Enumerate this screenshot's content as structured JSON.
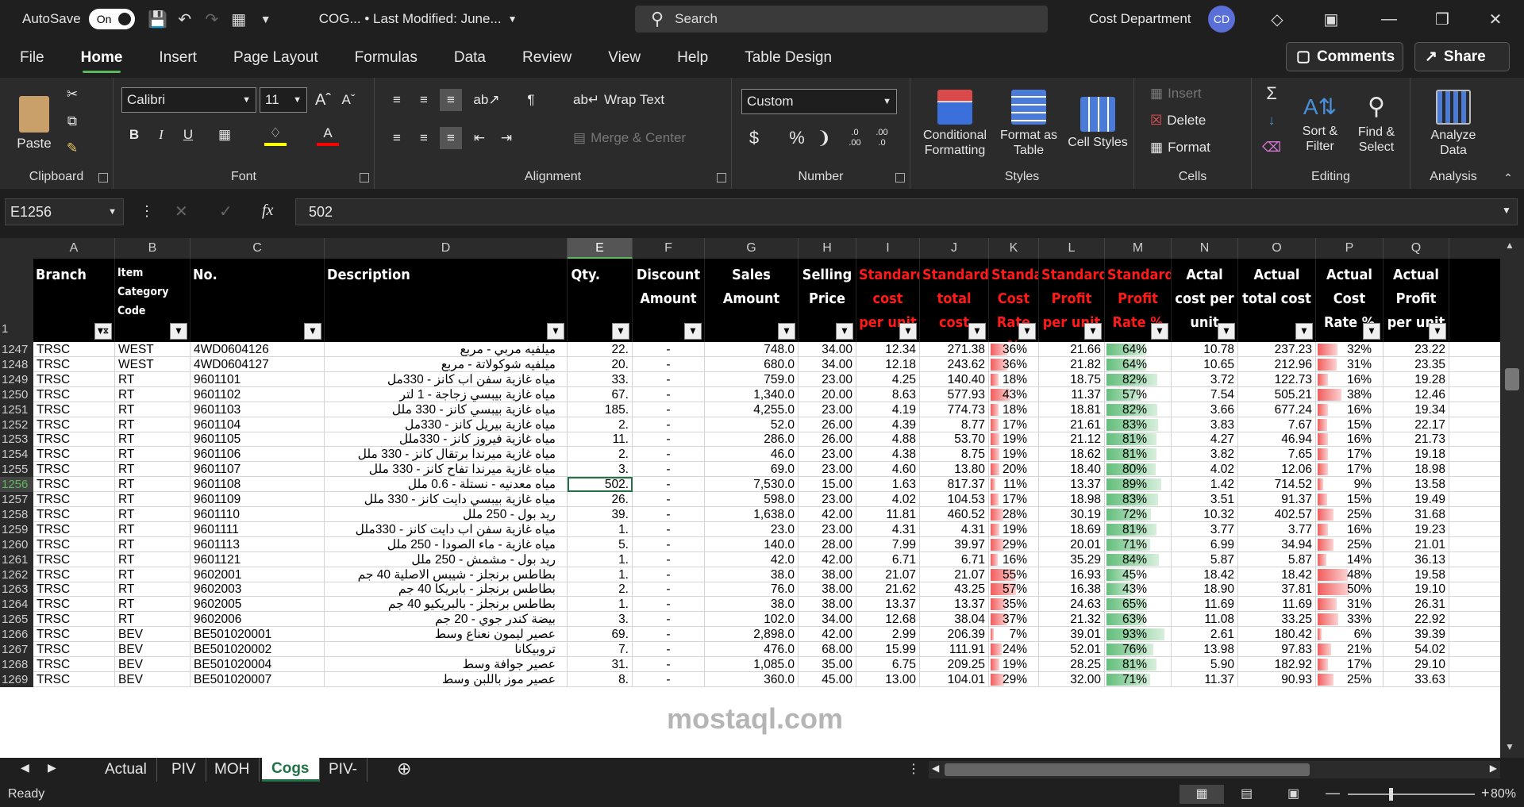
{
  "titlebar": {
    "autosave_label": "AutoSave",
    "autosave_state": "On",
    "file_title": "COG...  •  Last Modified: June...",
    "search_placeholder": "Search",
    "user_name": "Cost Department",
    "user_initials": "CD"
  },
  "menu": {
    "tabs": [
      "File",
      "Home",
      "Insert",
      "Page Layout",
      "Formulas",
      "Data",
      "Review",
      "View",
      "Help",
      "Table Design"
    ],
    "active": "Home",
    "comments_label": "Comments",
    "share_label": "Share"
  },
  "ribbon": {
    "clipboard": {
      "label": "Clipboard",
      "paste": "Paste"
    },
    "font": {
      "label": "Font",
      "font_name": "Calibri",
      "font_size": "11"
    },
    "alignment": {
      "label": "Alignment",
      "wrap_text": "Wrap Text",
      "merge_center": "Merge & Center"
    },
    "number": {
      "label": "Number",
      "format": "Custom"
    },
    "styles": {
      "label": "Styles",
      "conditional": "Conditional Formatting",
      "format_table": "Format as Table",
      "cell_styles": "Cell Styles"
    },
    "cells": {
      "label": "Cells",
      "insert": "Insert",
      "delete": "Delete",
      "format": "Format"
    },
    "editing": {
      "label": "Editing",
      "sort_filter": "Sort & Filter",
      "find_select": "Find & Select"
    },
    "analysis": {
      "label": "Analysis",
      "analyze": "Analyze Data"
    }
  },
  "formula_bar": {
    "name_box": "E1256",
    "fx": "fx",
    "formula": "502"
  },
  "columns": [
    "A",
    "B",
    "C",
    "D",
    "E",
    "F",
    "G",
    "H",
    "I",
    "J",
    "K",
    "L",
    "M",
    "N",
    "O",
    "P",
    "Q"
  ],
  "selected_column": "E",
  "header_row_number": "1",
  "headers": [
    "Branch",
    "Item Category Code",
    "No.",
    "Description",
    "Qty.",
    "Discount Amount",
    "Sales Amount",
    "Selling Price",
    "Standard cost per unit",
    "Standard total cost",
    "Standard Cost Rate %",
    "Standard Profit per unit",
    "Standard Profit Rate %",
    "Actal cost per unit",
    "Actual total cost",
    "Actual Cost Rate %",
    "Actual Profit per unit"
  ],
  "rows": [
    {
      "n": "1247",
      "a": "TRSC",
      "b": "WEST",
      "c": "4WD0604126",
      "d": "ميلفيه مربي - مربع",
      "e": "22.",
      "f": "-",
      "g": "748.0",
      "h": "34.00",
      "i": "12.34",
      "j": "271.38",
      "k": "36%",
      "kv": 36,
      "l": "21.66",
      "m": "64%",
      "mv": 64,
      "n2": "10.78",
      "o": "237.23",
      "p": "32%",
      "pv": 32,
      "q": "23.22"
    },
    {
      "n": "1248",
      "a": "TRSC",
      "b": "WEST",
      "c": "4WD0604127",
      "d": "ميلفيه شوكولاتة - مربع",
      "e": "20.",
      "f": "-",
      "g": "680.0",
      "h": "34.00",
      "i": "12.18",
      "j": "243.62",
      "k": "36%",
      "kv": 36,
      "l": "21.82",
      "m": "64%",
      "mv": 64,
      "n2": "10.65",
      "o": "212.96",
      "p": "31%",
      "pv": 31,
      "q": "23.35"
    },
    {
      "n": "1249",
      "a": "TRSC",
      "b": "RT",
      "c": "9601101",
      "d": "مياه غازية سفن اب كانز - 330مل",
      "e": "33.",
      "f": "-",
      "g": "759.0",
      "h": "23.00",
      "i": "4.25",
      "j": "140.40",
      "k": "18%",
      "kv": 18,
      "l": "18.75",
      "m": "82%",
      "mv": 82,
      "n2": "3.72",
      "o": "122.73",
      "p": "16%",
      "pv": 16,
      "q": "19.28"
    },
    {
      "n": "1250",
      "a": "TRSC",
      "b": "RT",
      "c": "9601102",
      "d": "مياه غازية بيبسي زجاجة - 1 لتر",
      "e": "67.",
      "f": "-",
      "g": "1,340.0",
      "h": "20.00",
      "i": "8.63",
      "j": "577.93",
      "k": "43%",
      "kv": 43,
      "l": "11.37",
      "m": "57%",
      "mv": 57,
      "n2": "7.54",
      "o": "505.21",
      "p": "38%",
      "pv": 38,
      "q": "12.46"
    },
    {
      "n": "1251",
      "a": "TRSC",
      "b": "RT",
      "c": "9601103",
      "d": "مياه غازية بيبسي كانز - 330 ملل",
      "e": "185.",
      "f": "-",
      "g": "4,255.0",
      "h": "23.00",
      "i": "4.19",
      "j": "774.73",
      "k": "18%",
      "kv": 18,
      "l": "18.81",
      "m": "82%",
      "mv": 82,
      "n2": "3.66",
      "o": "677.24",
      "p": "16%",
      "pv": 16,
      "q": "19.34"
    },
    {
      "n": "1252",
      "a": "TRSC",
      "b": "RT",
      "c": "9601104",
      "d": "مياه غازية بيريل كانز - 330مل",
      "e": "2.",
      "f": "-",
      "g": "52.0",
      "h": "26.00",
      "i": "4.39",
      "j": "8.77",
      "k": "17%",
      "kv": 17,
      "l": "21.61",
      "m": "83%",
      "mv": 83,
      "n2": "3.83",
      "o": "7.67",
      "p": "15%",
      "pv": 15,
      "q": "22.17"
    },
    {
      "n": "1253",
      "a": "TRSC",
      "b": "RT",
      "c": "9601105",
      "d": "مياه غازية فيروز كانز - 330ملل",
      "e": "11.",
      "f": "-",
      "g": "286.0",
      "h": "26.00",
      "i": "4.88",
      "j": "53.70",
      "k": "19%",
      "kv": 19,
      "l": "21.12",
      "m": "81%",
      "mv": 81,
      "n2": "4.27",
      "o": "46.94",
      "p": "16%",
      "pv": 16,
      "q": "21.73"
    },
    {
      "n": "1254",
      "a": "TRSC",
      "b": "RT",
      "c": "9601106",
      "d": "مياه غازية ميرندا برتقال كانز - 330 ملل",
      "e": "2.",
      "f": "-",
      "g": "46.0",
      "h": "23.00",
      "i": "4.38",
      "j": "8.75",
      "k": "19%",
      "kv": 19,
      "l": "18.62",
      "m": "81%",
      "mv": 81,
      "n2": "3.82",
      "o": "7.65",
      "p": "17%",
      "pv": 17,
      "q": "19.18"
    },
    {
      "n": "1255",
      "a": "TRSC",
      "b": "RT",
      "c": "9601107",
      "d": "مياه غازية ميرندا تفاح كانز - 330 ملل",
      "e": "3.",
      "f": "-",
      "g": "69.0",
      "h": "23.00",
      "i": "4.60",
      "j": "13.80",
      "k": "20%",
      "kv": 20,
      "l": "18.40",
      "m": "80%",
      "mv": 80,
      "n2": "4.02",
      "o": "12.06",
      "p": "17%",
      "pv": 17,
      "q": "18.98"
    },
    {
      "n": "1256",
      "a": "TRSC",
      "b": "RT",
      "c": "9601108",
      "d": "مياه معدنيه - نستلة - 0.6 ملل",
      "e": "502.",
      "f": "-",
      "g": "7,530.0",
      "h": "15.00",
      "i": "1.63",
      "j": "817.37",
      "k": "11%",
      "kv": 11,
      "l": "13.37",
      "m": "89%",
      "mv": 89,
      "n2": "1.42",
      "o": "714.52",
      "p": "9%",
      "pv": 9,
      "q": "13.58",
      "sel": true
    },
    {
      "n": "1257",
      "a": "TRSC",
      "b": "RT",
      "c": "9601109",
      "d": "مياه غازية بيبسي دايت كانز - 330 ملل",
      "e": "26.",
      "f": "-",
      "g": "598.0",
      "h": "23.00",
      "i": "4.02",
      "j": "104.53",
      "k": "17%",
      "kv": 17,
      "l": "18.98",
      "m": "83%",
      "mv": 83,
      "n2": "3.51",
      "o": "91.37",
      "p": "15%",
      "pv": 15,
      "q": "19.49"
    },
    {
      "n": "1258",
      "a": "TRSC",
      "b": "RT",
      "c": "9601110",
      "d": "ريد بول - 250 ملل",
      "e": "39.",
      "f": "-",
      "g": "1,638.0",
      "h": "42.00",
      "i": "11.81",
      "j": "460.52",
      "k": "28%",
      "kv": 28,
      "l": "30.19",
      "m": "72%",
      "mv": 72,
      "n2": "10.32",
      "o": "402.57",
      "p": "25%",
      "pv": 25,
      "q": "31.68"
    },
    {
      "n": "1259",
      "a": "TRSC",
      "b": "RT",
      "c": "9601111",
      "d": "مياه غازية سفن اب دايت كانز - 330ملل",
      "e": "1.",
      "f": "-",
      "g": "23.0",
      "h": "23.00",
      "i": "4.31",
      "j": "4.31",
      "k": "19%",
      "kv": 19,
      "l": "18.69",
      "m": "81%",
      "mv": 81,
      "n2": "3.77",
      "o": "3.77",
      "p": "16%",
      "pv": 16,
      "q": "19.23"
    },
    {
      "n": "1260",
      "a": "TRSC",
      "b": "RT",
      "c": "9601113",
      "d": "مياه غازية - ماء الصودا - 250 ملل",
      "e": "5.",
      "f": "-",
      "g": "140.0",
      "h": "28.00",
      "i": "7.99",
      "j": "39.97",
      "k": "29%",
      "kv": 29,
      "l": "20.01",
      "m": "71%",
      "mv": 71,
      "n2": "6.99",
      "o": "34.94",
      "p": "25%",
      "pv": 25,
      "q": "21.01"
    },
    {
      "n": "1261",
      "a": "TRSC",
      "b": "RT",
      "c": "9601121",
      "d": "ريد بول - مشمش - 250 ملل",
      "e": "1.",
      "f": "-",
      "g": "42.0",
      "h": "42.00",
      "i": "6.71",
      "j": "6.71",
      "k": "16%",
      "kv": 16,
      "l": "35.29",
      "m": "84%",
      "mv": 84,
      "n2": "5.87",
      "o": "5.87",
      "p": "14%",
      "pv": 14,
      "q": "36.13"
    },
    {
      "n": "1262",
      "a": "TRSC",
      "b": "RT",
      "c": "9602001",
      "d": "بطاطس برنجلز - شيبس الاصلية 40 جم",
      "e": "1.",
      "f": "-",
      "g": "38.0",
      "h": "38.00",
      "i": "21.07",
      "j": "21.07",
      "k": "55%",
      "kv": 55,
      "l": "16.93",
      "m": "45%",
      "mv": 45,
      "n2": "18.42",
      "o": "18.42",
      "p": "48%",
      "pv": 48,
      "q": "19.58"
    },
    {
      "n": "1263",
      "a": "TRSC",
      "b": "RT",
      "c": "9602003",
      "d": "بطاطس برنجلز - بابريكا 40 جم",
      "e": "2.",
      "f": "-",
      "g": "76.0",
      "h": "38.00",
      "i": "21.62",
      "j": "43.25",
      "k": "57%",
      "kv": 57,
      "l": "16.38",
      "m": "43%",
      "mv": 43,
      "n2": "18.90",
      "o": "37.81",
      "p": "50%",
      "pv": 50,
      "q": "19.10"
    },
    {
      "n": "1264",
      "a": "TRSC",
      "b": "RT",
      "c": "9602005",
      "d": "بطاطس برنجلز - بالبريكيو 40 جم",
      "e": "1.",
      "f": "-",
      "g": "38.0",
      "h": "38.00",
      "i": "13.37",
      "j": "13.37",
      "k": "35%",
      "kv": 35,
      "l": "24.63",
      "m": "65%",
      "mv": 65,
      "n2": "11.69",
      "o": "11.69",
      "p": "31%",
      "pv": 31,
      "q": "26.31"
    },
    {
      "n": "1265",
      "a": "TRSC",
      "b": "RT",
      "c": "9602006",
      "d": "بيضة كندر جوي - 20 جم",
      "e": "3.",
      "f": "-",
      "g": "102.0",
      "h": "34.00",
      "i": "12.68",
      "j": "38.04",
      "k": "37%",
      "kv": 37,
      "l": "21.32",
      "m": "63%",
      "mv": 63,
      "n2": "11.08",
      "o": "33.25",
      "p": "33%",
      "pv": 33,
      "q": "22.92"
    },
    {
      "n": "1266",
      "a": "TRSC",
      "b": "BEV",
      "c": "BE501020001",
      "d": "عصير ليمون نعناع وسط",
      "e": "69.",
      "f": "-",
      "g": "2,898.0",
      "h": "42.00",
      "i": "2.99",
      "j": "206.39",
      "k": "7%",
      "kv": 7,
      "l": "39.01",
      "m": "93%",
      "mv": 93,
      "n2": "2.61",
      "o": "180.42",
      "p": "6%",
      "pv": 6,
      "q": "39.39"
    },
    {
      "n": "1267",
      "a": "TRSC",
      "b": "BEV",
      "c": "BE501020002",
      "d": "تروبيكانا",
      "e": "7.",
      "f": "-",
      "g": "476.0",
      "h": "68.00",
      "i": "15.99",
      "j": "111.91",
      "k": "24%",
      "kv": 24,
      "l": "52.01",
      "m": "76%",
      "mv": 76,
      "n2": "13.98",
      "o": "97.83",
      "p": "21%",
      "pv": 21,
      "q": "54.02"
    },
    {
      "n": "1268",
      "a": "TRSC",
      "b": "BEV",
      "c": "BE501020004",
      "d": "عصير جوافة وسط",
      "e": "31.",
      "f": "-",
      "g": "1,085.0",
      "h": "35.00",
      "i": "6.75",
      "j": "209.25",
      "k": "19%",
      "kv": 19,
      "l": "28.25",
      "m": "81%",
      "mv": 81,
      "n2": "5.90",
      "o": "182.92",
      "p": "17%",
      "pv": 17,
      "q": "29.10"
    },
    {
      "n": "1269",
      "a": "TRSC",
      "b": "BEV",
      "c": "BE501020007",
      "d": "عصير موز باللبن وسط",
      "e": "8.",
      "f": "-",
      "g": "360.0",
      "h": "45.00",
      "i": "13.00",
      "j": "104.01",
      "k": "29%",
      "kv": 29,
      "l": "32.00",
      "m": "71%",
      "mv": 71,
      "n2": "11.37",
      "o": "90.93",
      "p": "25%",
      "pv": 25,
      "q": "33.63"
    }
  ],
  "sheets": [
    "Actual",
    "PIV",
    "MOH",
    "Cogs",
    "PIV-"
  ],
  "active_sheet": "Cogs",
  "status": {
    "ready": "Ready",
    "zoom": "80%"
  },
  "watermark": "mostaql.com",
  "colors": {
    "accent": "#217346",
    "header_red": "#ff1a1a",
    "bar_red": "#f25c5c",
    "bar_green": "#63be7b"
  }
}
